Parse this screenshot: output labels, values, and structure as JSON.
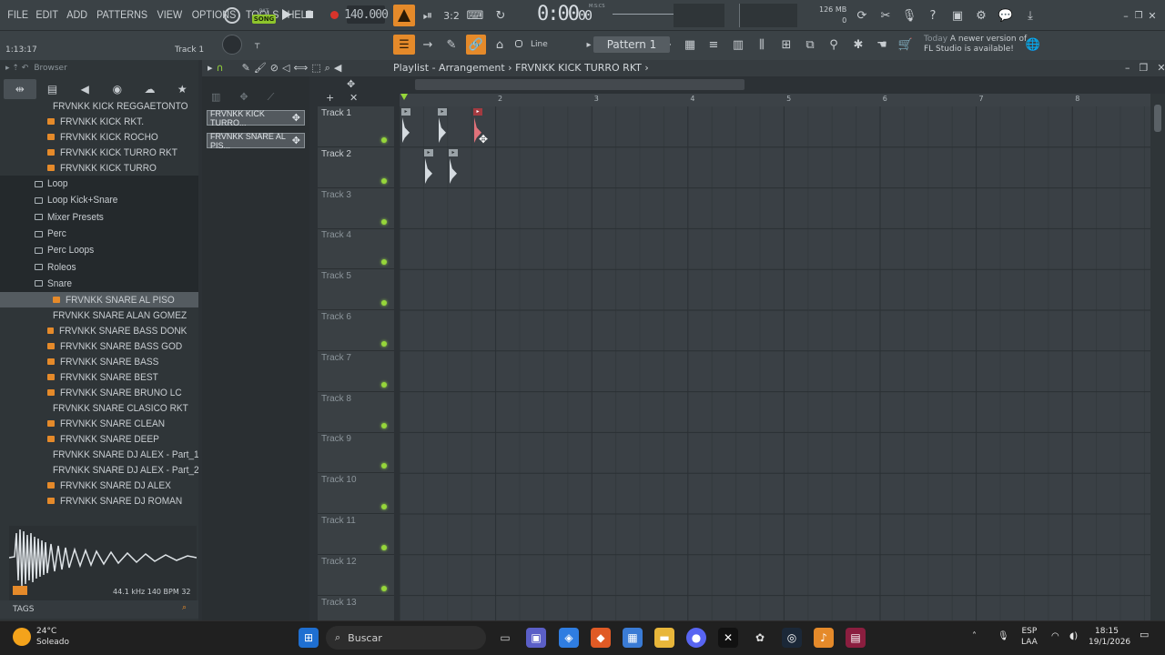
{
  "menu": [
    "FILE",
    "EDIT",
    "ADD",
    "PATTERNS",
    "VIEW",
    "OPTIONS",
    "TOOLS",
    "HELP"
  ],
  "transport": {
    "mode_label": "SONG",
    "pat_label": "PAT",
    "tempo": "140.000",
    "time_main": "0:00",
    "time_small": "00",
    "time_unit": "M:S:CS"
  },
  "status": {
    "memory": "126 MB",
    "voices": "0",
    "hint_time": "1:13:17",
    "hint_track": "Track 1",
    "news_today": "Today",
    "news_text": "A newer version of",
    "news_text2": "FL Studio is available!"
  },
  "toolbar": {
    "snap_label": "Line",
    "pattern_label": "Pattern 1"
  },
  "browser": {
    "title": "Browser",
    "items": [
      {
        "type": "file",
        "label": "FRVNKK KICK REGGAETONTO"
      },
      {
        "type": "file",
        "label": "FRVNKK KICK RKT."
      },
      {
        "type": "file",
        "label": "FRVNKK KICK ROCHO"
      },
      {
        "type": "file",
        "label": "FRVNKK KICK TURRO RKT"
      },
      {
        "type": "file",
        "label": "FRVNKK KICK TURRO"
      },
      {
        "type": "folder",
        "label": "Loop"
      },
      {
        "type": "folder",
        "label": "Loop Kick+Snare"
      },
      {
        "type": "folder",
        "label": "Mixer Presets"
      },
      {
        "type": "folder",
        "label": "Perc"
      },
      {
        "type": "folder",
        "label": "Perc Loops"
      },
      {
        "type": "folder",
        "label": "Roleos"
      },
      {
        "type": "folder",
        "label": "Snare"
      },
      {
        "type": "selected",
        "label": "FRVNKK SNARE AL PISO"
      },
      {
        "type": "file",
        "label": "FRVNKK SNARE ALAN GOMEZ"
      },
      {
        "type": "file",
        "label": "FRVNKK SNARE BASS DONK"
      },
      {
        "type": "file",
        "label": "FRVNKK SNARE BASS GOD"
      },
      {
        "type": "file",
        "label": "FRVNKK SNARE BASS"
      },
      {
        "type": "file",
        "label": "FRVNKK SNARE BEST"
      },
      {
        "type": "file",
        "label": "FRVNKK SNARE BRUNO LC"
      },
      {
        "type": "file",
        "label": "FRVNKK SNARE CLASICO RKT"
      },
      {
        "type": "file",
        "label": "FRVNKK SNARE CLEAN"
      },
      {
        "type": "file",
        "label": "FRVNKK SNARE DEEP"
      },
      {
        "type": "file",
        "label": "FRVNKK SNARE DJ ALEX - Part_1"
      },
      {
        "type": "file",
        "label": "FRVNKK SNARE DJ ALEX - Part_2"
      },
      {
        "type": "file",
        "label": "FRVNKK SNARE DJ ALEX"
      },
      {
        "type": "file",
        "label": "FRVNKK SNARE DJ ROMAN"
      }
    ],
    "sample_info": "44.1 kHz 140 BPM 32",
    "tags_label": "TAGS"
  },
  "picker": [
    "FRVNKK KICK TURRO...",
    "FRVNKK SNARE AL PIS..."
  ],
  "playlist": {
    "title": "Playlist - Arrangement",
    "pattern_name": "FRVNKK KICK TURRO RKT",
    "bars": [
      "2",
      "3",
      "4",
      "5",
      "6",
      "7",
      "8"
    ],
    "tracks": [
      "Track 1",
      "Track 2",
      "Track 3",
      "Track 4",
      "Track 5",
      "Track 6",
      "Track 7",
      "Track 8",
      "Track 9",
      "Track 10",
      "Track 11",
      "Track 12",
      "Track 13"
    ]
  },
  "taskbar": {
    "weather_temp": "24°C",
    "weather_desc": "Soleado",
    "search": "Buscar",
    "lang": "ESP",
    "lang2": "LAA",
    "time": "18:15",
    "date": "19/1/2026"
  }
}
